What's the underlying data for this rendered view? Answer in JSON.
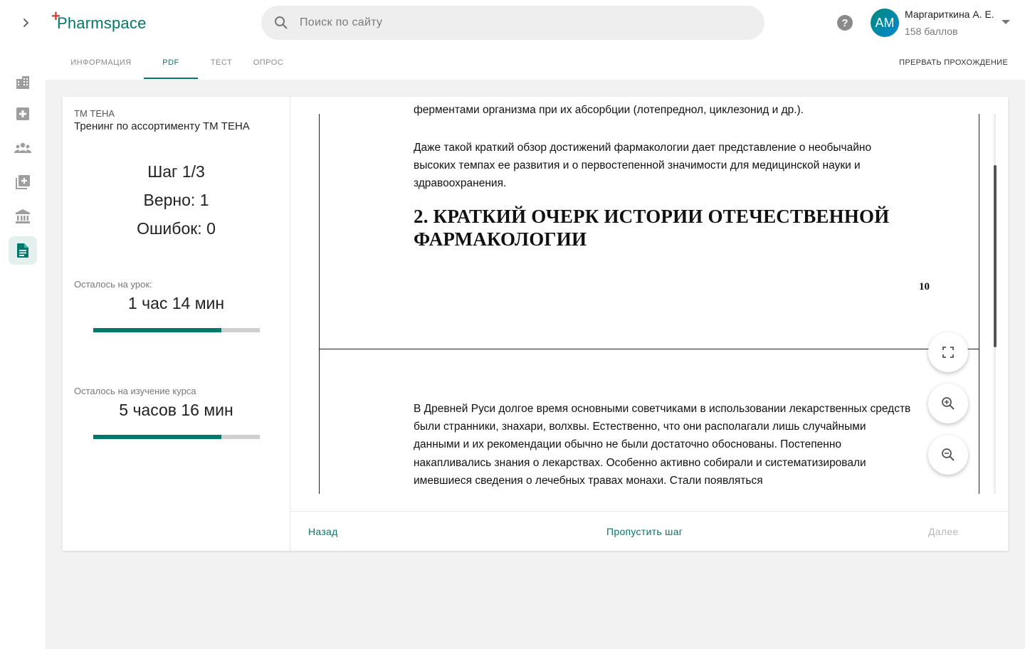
{
  "header": {
    "logo_text": "Pharmspace",
    "search_placeholder": "Поиск по сайту",
    "user": {
      "initials": "AM",
      "name": "Маргариткина А. Е.",
      "points": "158 баллов"
    }
  },
  "tabs": [
    {
      "label": "ИНФОРМАЦИЯ",
      "active": false
    },
    {
      "label": "PDF",
      "active": true
    },
    {
      "label": "ТЕСТ",
      "active": false
    },
    {
      "label": "ОПРОС",
      "active": false
    }
  ],
  "abort_label": "ПРЕРВАТЬ ПРОХОЖДЕНИЕ",
  "sidebar": {
    "icons": [
      "building-icon",
      "medical-plus-icon",
      "people-icon",
      "add-library-icon",
      "institution-icon",
      "document-icon"
    ],
    "active_index": 5
  },
  "course": {
    "brand": "ТМ ТЕНА",
    "title": "Тренинг по ассортименту ТМ ТЕНА",
    "step": "Шаг 1/3",
    "correct": "Верно: 1",
    "errors": "Ошибок: 0",
    "lesson_remaining_label": "Осталось на урок:",
    "lesson_remaining_value": "1 час 14 мин",
    "lesson_progress": 0.77,
    "course_remaining_label": "Осталось на изучение курса",
    "course_remaining_value": "5 часов 16 мин",
    "course_progress": 0.77
  },
  "pdf": {
    "line_top": "ферментами организма при их абсорбции (лотепреднол, циклезонид и др.).",
    "paragraph1": "Даже такой краткий обзор достижений фармакологии дает представление о необычайно высоких темпах ее развития и о первостепенной значимости для медицинской науки и здравоохранения.",
    "heading": "2. КРАТКИЙ ОЧЕРК ИСТОРИИ ОТЕЧЕСТВЕННОЙ ФАРМАКОЛОГИИ",
    "page_number": "10",
    "paragraph2": "В Древней Руси долгое время основными советчиками в использовании лекарственных средств были странники, знахари, волхвы. Естественно, что они располагали лишь случайными данными и их рекомендации обычно не были достаточно обоснованы. Постепенно накапливались знания о лекарствах. Особенно активно собирали и систематизировали имевшиеся сведения о лечебных травах монахи. Стали появляться"
  },
  "footer": {
    "back": "Назад",
    "skip": "Пропустить шаг",
    "next": "Далее"
  },
  "colors": {
    "accent": "#00796b",
    "logo_cross": "#e53935",
    "disabled": "#b8b8b8"
  }
}
